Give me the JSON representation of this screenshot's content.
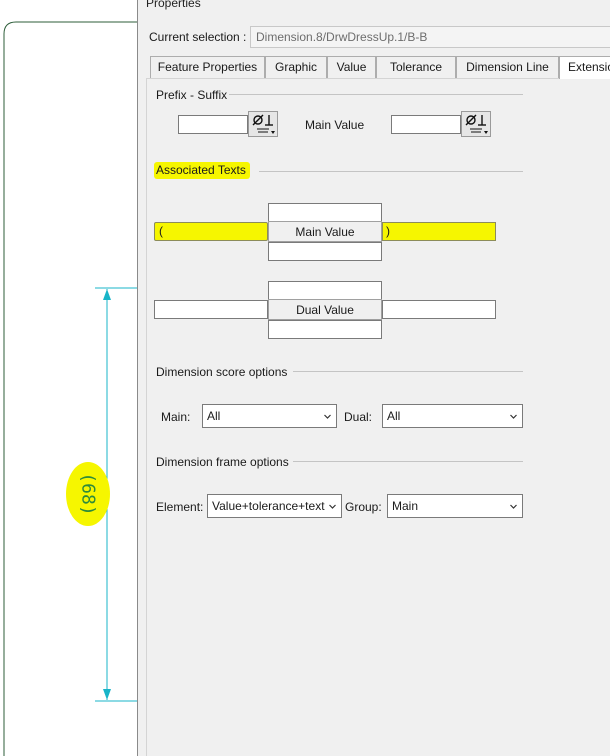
{
  "dialog": {
    "title": "Properties",
    "current_selection_label": "Current selection :",
    "current_selection_value": "Dimension.8/DrwDressUp.1/B-B"
  },
  "tabs": [
    {
      "label": "Feature Properties",
      "active": false
    },
    {
      "label": "Graphic",
      "active": false
    },
    {
      "label": "Value",
      "active": false
    },
    {
      "label": "Tolerance",
      "active": false
    },
    {
      "label": "Dimension Line",
      "active": false
    },
    {
      "label": "Extensio",
      "active": true
    }
  ],
  "prefix_suffix": {
    "heading": "Prefix - Suffix",
    "prefix_value": "",
    "main_value_label": "Main Value",
    "suffix_value": "",
    "symbol_icon": "diameter-symbol-icon"
  },
  "associated_texts": {
    "heading": "Associated Texts",
    "main_top": "",
    "main_left": "(",
    "main_center_label": "Main Value",
    "main_right": ")",
    "main_bottom": "",
    "dual_top": "",
    "dual_left": "",
    "dual_center_label": "Dual Value",
    "dual_right": "",
    "dual_bottom": ""
  },
  "score_options": {
    "heading": "Dimension score options",
    "main_label": "Main:",
    "main_value": "All",
    "dual_label": "Dual:",
    "dual_value": "All"
  },
  "frame_options": {
    "heading": "Dimension frame options",
    "element_label": "Element:",
    "element_value": "Value+tolerance+text",
    "group_label": "Group:",
    "group_value": "Main"
  },
  "drawing": {
    "dimension_text": "(68)"
  },
  "colors": {
    "highlight": "#f6f600",
    "dimension_line": "#18b4c8",
    "dimension_text": "#2e8b3a"
  }
}
